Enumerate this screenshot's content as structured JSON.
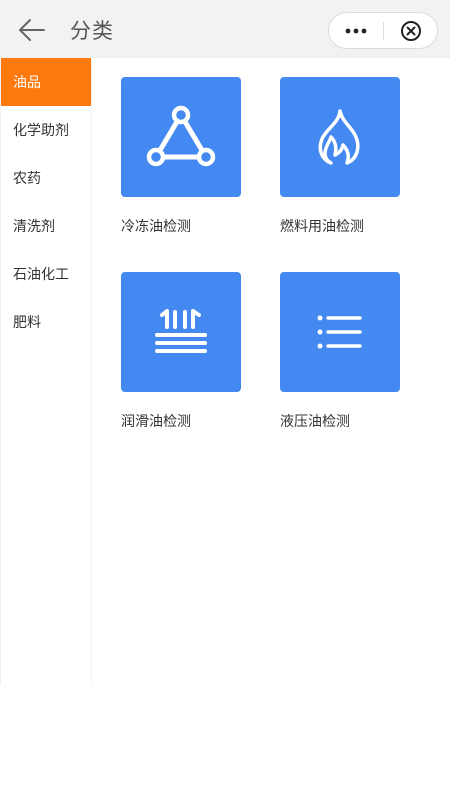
{
  "header": {
    "title": "分类",
    "back_icon": "arrow-left-icon",
    "more_icon": "more-dots-icon",
    "close_icon": "close-circle-icon"
  },
  "sidebar": {
    "active_color": "#ff7a0e",
    "items": [
      {
        "label": "油品",
        "active": true
      },
      {
        "label": "化学助剂",
        "active": false
      },
      {
        "label": "农药",
        "active": false
      },
      {
        "label": "清洗剂",
        "active": false
      },
      {
        "label": "石油化工",
        "active": false
      },
      {
        "label": "肥料",
        "active": false
      }
    ]
  },
  "categories": {
    "tile_color": "#4488f2",
    "items": [
      {
        "label": "冷冻油检测",
        "icon": "triangle-network-icon"
      },
      {
        "label": "燃料用油检测",
        "icon": "flame-icon"
      },
      {
        "label": "润滑油检测",
        "icon": "lubrication-icon"
      },
      {
        "label": "液压油检测",
        "icon": "list-icon"
      }
    ]
  }
}
